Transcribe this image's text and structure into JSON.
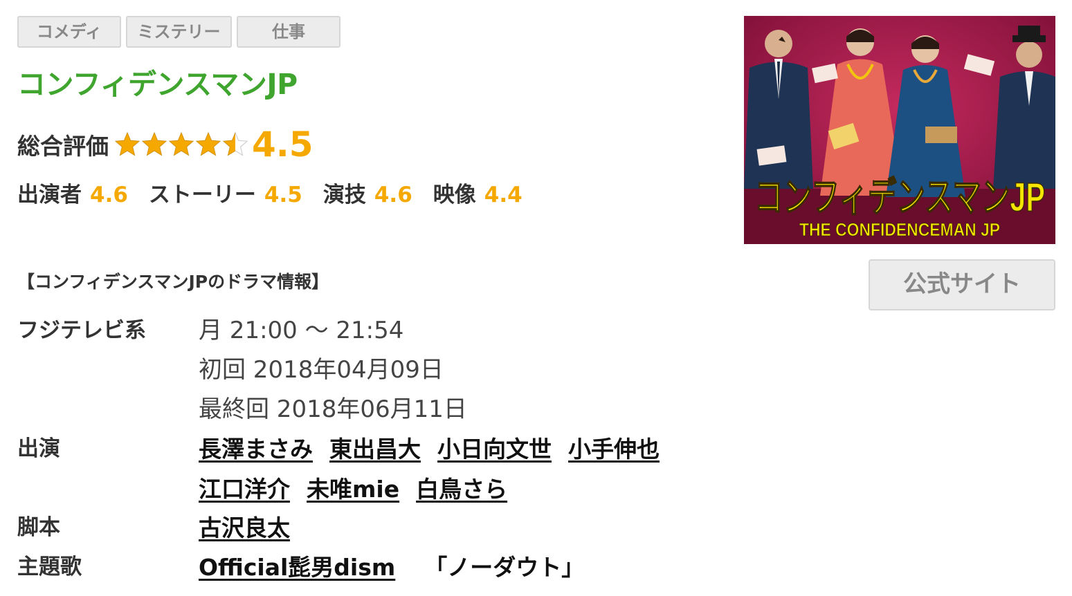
{
  "tags": [
    "コメディ",
    "ミステリー",
    "仕事"
  ],
  "title": "コンフィデンスマンJP",
  "rating": {
    "label": "総合評価",
    "score": "4.5",
    "stars_filled": 4.5,
    "stars_total": 5,
    "star_color": "#f5a800",
    "sub": [
      {
        "label": "出演者",
        "score": "4.6"
      },
      {
        "label": "ストーリー",
        "score": "4.5"
      },
      {
        "label": "演技",
        "score": "4.6"
      },
      {
        "label": "映像",
        "score": "4.4"
      }
    ]
  },
  "poster": {
    "logo_text": "コンフィデンスマンJP",
    "logo_sub": "THE CONFIDENCEMAN JP",
    "background_color": "#a8174a",
    "logo_color": "#f5e500"
  },
  "official_button": "公式サイト",
  "section_heading": "【コンフィデンスマンJPのドラマ情報】",
  "broadcast": {
    "label": "フジテレビ系",
    "schedule": "月 21:00 ～ 21:54",
    "first": "初回 2018年04月09日",
    "last": "最終回 2018年06月11日"
  },
  "cast": {
    "label": "出演",
    "row1": [
      "長澤まさみ",
      "東出昌大",
      "小日向文世",
      "小手伸也"
    ],
    "row2": [
      "江口洋介",
      "未唯mie",
      "白鳥さら"
    ]
  },
  "screenplay": {
    "label": "脚本",
    "name": "古沢良太"
  },
  "theme_song": {
    "label": "主題歌",
    "artist": "Official髭男dism",
    "song": "「ノーダウト」"
  },
  "colors": {
    "title_green": "#3fa52f",
    "accent_orange": "#f5a800"
  }
}
